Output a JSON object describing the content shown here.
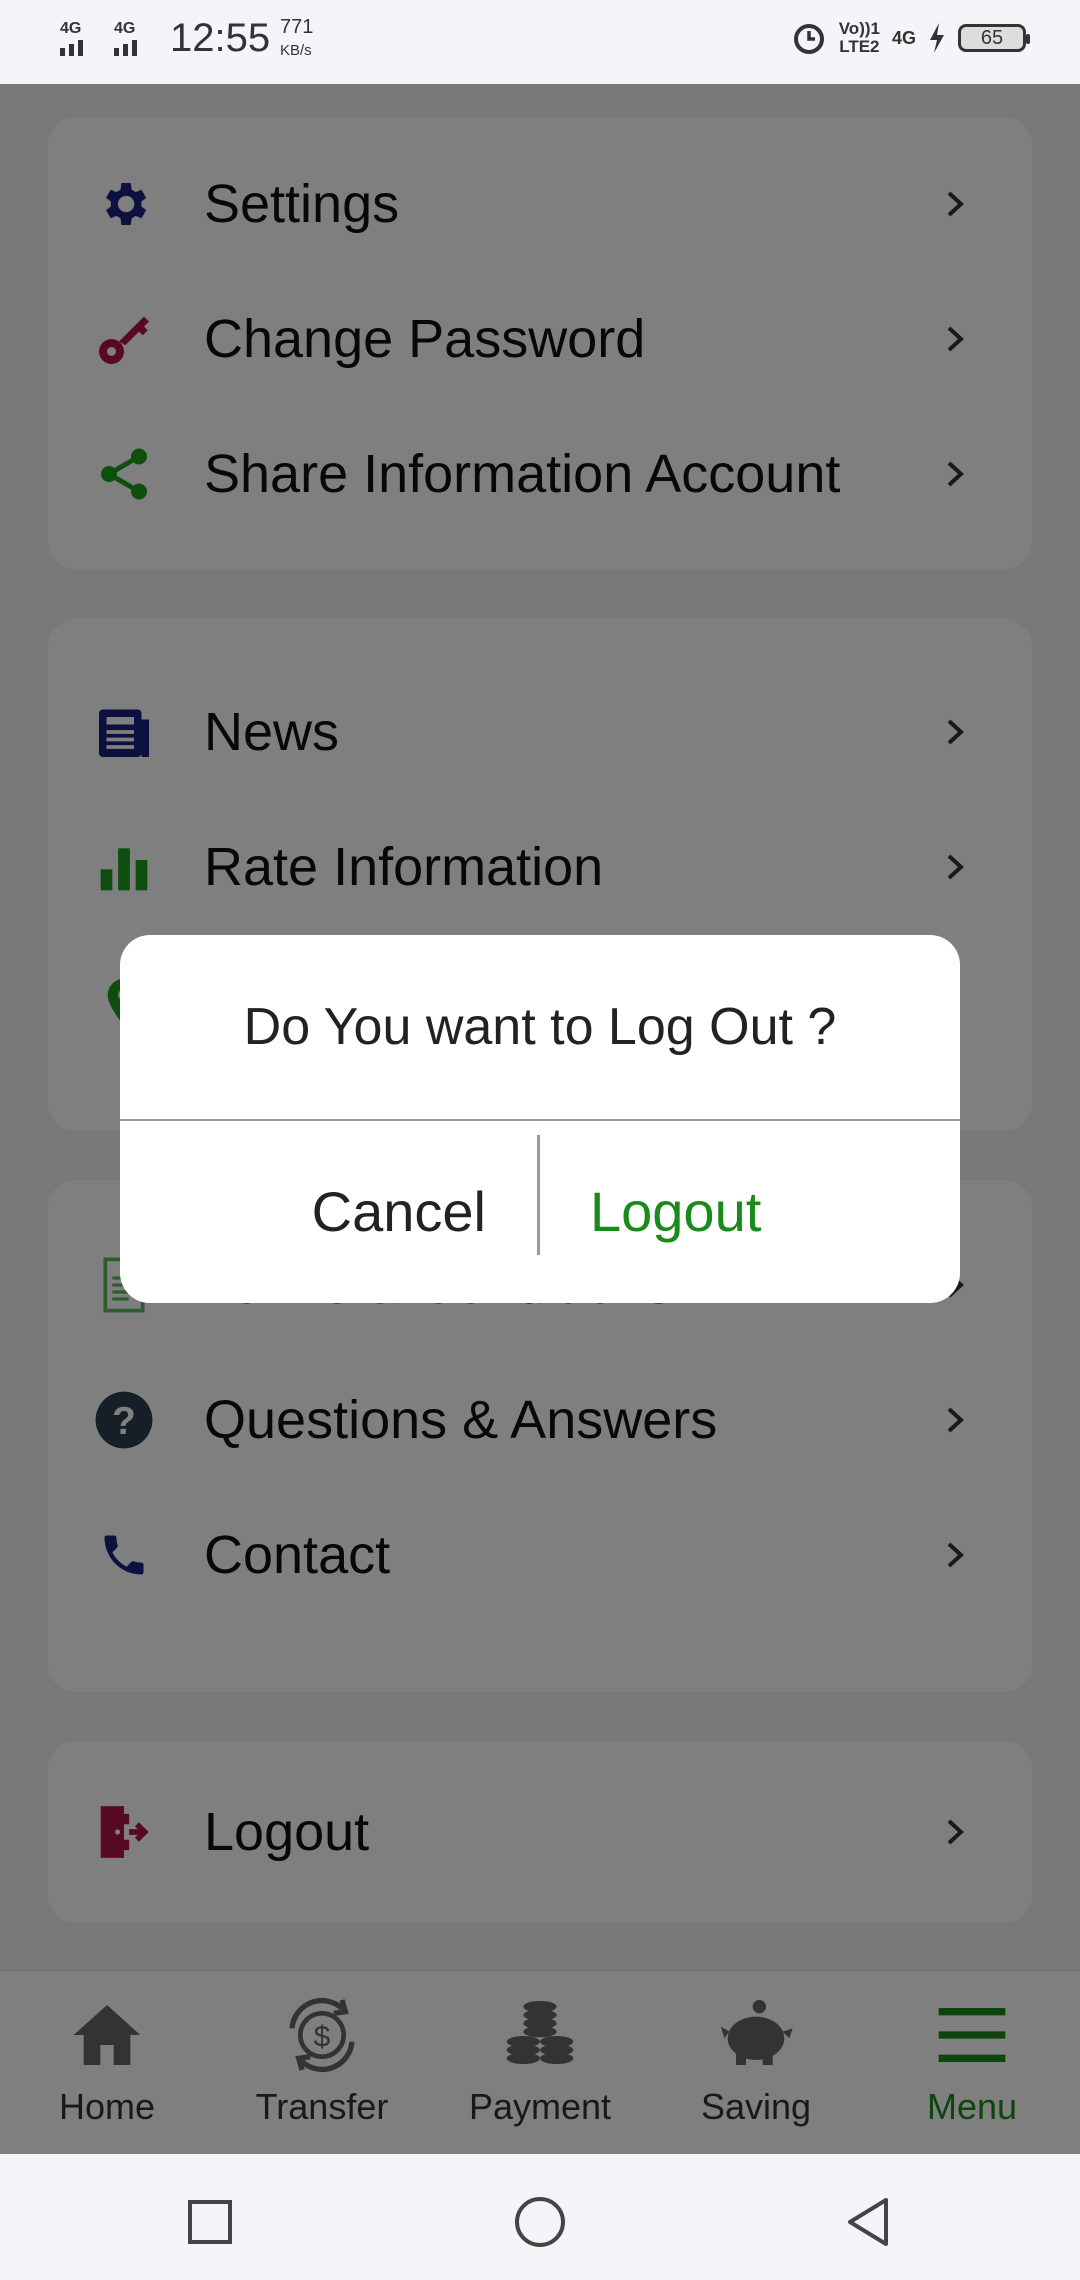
{
  "status_bar": {
    "sim1": "4G",
    "sim2": "4G",
    "time": "12:55",
    "speed_value": "771",
    "speed_unit": "KB/s",
    "volte_top": "Vo))1",
    "volte_bottom": "LTE2",
    "net": "4G",
    "battery": "65"
  },
  "menu": {
    "group1": [
      {
        "label": "Settings",
        "icon": "gear-icon",
        "color": "#1a237e"
      },
      {
        "label": "Change Password",
        "icon": "key-icon",
        "color": "#b0124a"
      },
      {
        "label": "Share Information Account",
        "icon": "share-icon",
        "color": "#1aa01a"
      }
    ],
    "group2": [
      {
        "label": "News",
        "icon": "newspaper-icon",
        "color": "#1a237e"
      },
      {
        "label": "Rate Information",
        "icon": "bar-chart-icon",
        "color": "#1a9a1a"
      }
    ],
    "group3": [
      {
        "label": "Terms & Conditions",
        "icon": "document-icon",
        "color": "#5cb85c"
      },
      {
        "label": "Questions & Answers",
        "icon": "question-icon",
        "color": "#2c3e50"
      },
      {
        "label": "Contact",
        "icon": "phone-icon",
        "color": "#1a237e"
      }
    ],
    "group4": [
      {
        "label": "Logout",
        "icon": "logout-icon",
        "color": "#b0124a"
      }
    ]
  },
  "tabbar": {
    "items": [
      {
        "label": "Home",
        "icon": "home-icon"
      },
      {
        "label": "Transfer",
        "icon": "transfer-icon"
      },
      {
        "label": "Payment",
        "icon": "coins-icon"
      },
      {
        "label": "Saving",
        "icon": "piggy-bank-icon"
      },
      {
        "label": "Menu",
        "icon": "hamburger-icon",
        "active": true
      }
    ],
    "active_color": "#1a8a1a"
  },
  "dialog": {
    "title": "Do You want to Log Out ?",
    "cancel_label": "Cancel",
    "logout_label": "Logout",
    "logout_color": "#1a8a1a"
  }
}
